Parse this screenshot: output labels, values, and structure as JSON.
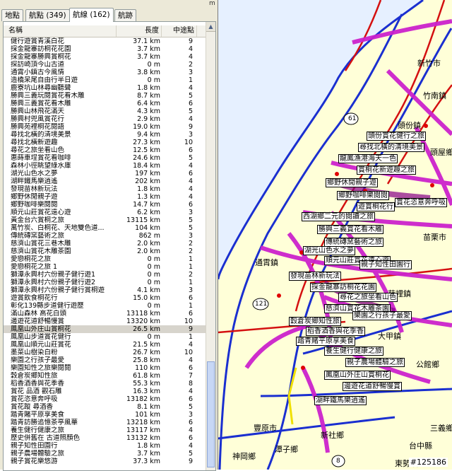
{
  "tabs": [
    {
      "label": "地點",
      "active": false
    },
    {
      "label": "航點 (349)",
      "active": false
    },
    {
      "label": "航線 (162)",
      "active": true
    },
    {
      "label": "航跡",
      "active": false
    }
  ],
  "top_tick": "m",
  "columns": {
    "name": "名稱",
    "length": "長度",
    "waypoints": "中途點"
  },
  "rows": [
    {
      "name": "健行遊賞青溪白花",
      "length": "37.1 km",
      "pts": "9"
    },
    {
      "name": "採金龍寨訪桐花花園",
      "length": "3.7 km",
      "pts": "4"
    },
    {
      "name": "採金龍寨勝興賞桐花",
      "length": "3.7 km",
      "pts": "4"
    },
    {
      "name": "探訪崎頂今山古道",
      "length": "0 m",
      "pts": "2"
    },
    {
      "name": "通霄小鎮古今風情",
      "length": "3.8 km",
      "pts": "3"
    },
    {
      "name": "造橋呆尾自由行半日遊",
      "length": "0 m",
      "pts": "1"
    },
    {
      "name": "鹿寮坑山林尋幽聽聲",
      "length": "1.8 km",
      "pts": "4"
    },
    {
      "name": "勝興三義玩閱賞花看木雕",
      "length": "8.7 km",
      "pts": "5"
    },
    {
      "name": "勝興三義賞花看木雕",
      "length": "6.4 km",
      "pts": "6"
    },
    {
      "name": "勝興山林飛花滿天",
      "length": "4.3 km",
      "pts": "5"
    },
    {
      "name": "勝興村兜風賞花行",
      "length": "2.9 km",
      "pts": "4"
    },
    {
      "name": "勝興苑裡桐花閱語",
      "length": "19.0 km",
      "pts": "9"
    },
    {
      "name": "尋找北橫的清境美景",
      "length": "9.4 km",
      "pts": "3"
    },
    {
      "name": "尋找北橫新遊趣",
      "length": "27.3 km",
      "pts": "10"
    },
    {
      "name": "尋花之旅坐看山色",
      "length": "12.5 km",
      "pts": "6"
    },
    {
      "name": "惠蒔車埕賞花看咖啡",
      "length": "24.6 km",
      "pts": "5"
    },
    {
      "name": "森林小徑眺望綠水庫",
      "length": "18.4 km",
      "pts": "4"
    },
    {
      "name": "湖光山色水之夢",
      "length": "197 km",
      "pts": "6"
    },
    {
      "name": "湖畔鐵馬樂逍遙",
      "length": "202 km",
      "pts": "4"
    },
    {
      "name": "發現苗林新玩法",
      "length": "1.8 km",
      "pts": "4"
    },
    {
      "name": "鄉野休閒親子遊",
      "length": "1.3 km",
      "pts": "4"
    },
    {
      "name": "鄉野咖啡樂閱閱",
      "length": "14.7 km",
      "pts": "6"
    },
    {
      "name": "順元山莊賞花遠心遊",
      "length": "6.2 km",
      "pts": "3"
    },
    {
      "name": "黃金台六賞桐之旅",
      "length": "13115 km",
      "pts": "5"
    },
    {
      "name": "萬竹炭、白桐花、天地雙色道...",
      "length": "104 km",
      "pts": "5"
    },
    {
      "name": "傳統磚窯藝術之旅",
      "length": "862 m",
      "pts": "3"
    },
    {
      "name": "慈濟山賞花三巷木雕",
      "length": "2.0 km",
      "pts": "2"
    },
    {
      "name": "慈濟山賞花木雕茶園",
      "length": "2.0 km",
      "pts": "2"
    },
    {
      "name": "愛戀桐花之旅",
      "length": "0 m",
      "pts": "1"
    },
    {
      "name": "愛戀桐花之旅 1",
      "length": "0 m",
      "pts": "1"
    },
    {
      "name": "獅潭永興村六份親子健行遊1",
      "length": "0 m",
      "pts": "2"
    },
    {
      "name": "獅潭永興村六份親子健行遊2",
      "length": "0 m",
      "pts": "1"
    },
    {
      "name": "獅潭永興村六份親子健行賞桐遊",
      "length": "4.1 km",
      "pts": "3"
    },
    {
      "name": "遊賞飲食桐花行",
      "length": "15.0 km",
      "pts": "6"
    },
    {
      "name": "彰化139縣步道健行遊歷",
      "length": "0 m",
      "pts": "1"
    },
    {
      "name": "滿山森林 高花白頭",
      "length": "13118 km",
      "pts": "6"
    },
    {
      "name": "邊遊花道舒暢慢賞",
      "length": "13320 km",
      "pts": "10"
    },
    {
      "name": "鳳凰山外庄山賞桐花",
      "length": "26.5 km",
      "pts": "9",
      "selected": true
    },
    {
      "name": "鳳凰山步道賞花健行",
      "length": "0 m",
      "pts": "1"
    },
    {
      "name": "鳳凰山順元山莊賞花",
      "length": "21.5 km",
      "pts": "4"
    },
    {
      "name": "墨菜山樹染白粉",
      "length": "26.7 km",
      "pts": "10"
    },
    {
      "name": "樂園之行孩子最愛",
      "length": "25.8 km",
      "pts": "4"
    },
    {
      "name": "樂園知性之旅樂閱閱",
      "length": "110 km",
      "pts": "6"
    },
    {
      "name": "穀倉炭鄉知性旅",
      "length": "61.8 km",
      "pts": "7"
    },
    {
      "name": "稻香酒香與花季香",
      "length": "55.3 km",
      "pts": "8"
    },
    {
      "name": "賞花 品酒 觀石雕",
      "length": "16.3 km",
      "pts": "4"
    },
    {
      "name": "賞花恣意奔呼吸",
      "length": "13182 km",
      "pts": "6"
    },
    {
      "name": "賞花蹤  尋酒香",
      "length": "8.1 km",
      "pts": "5"
    },
    {
      "name": "踏青賭平原享美食",
      "length": "101 km",
      "pts": "3"
    },
    {
      "name": "踏青訪勝追憶茶亭風華",
      "length": "13218 km",
      "pts": "6"
    },
    {
      "name": "養生健行健康之旅",
      "length": "13117 km",
      "pts": "4"
    },
    {
      "name": "歷史併舊在 古道照顏色",
      "length": "13132 km",
      "pts": "6"
    },
    {
      "name": "親子知性田園行",
      "length": "1.8 km",
      "pts": "4"
    },
    {
      "name": "親子農場體驗之旅",
      "length": "3.7 km",
      "pts": "5"
    },
    {
      "name": "親子賞花樂悠游",
      "length": "37.3 km",
      "pts": "9"
    }
  ],
  "map": {
    "road_labels": [
      "61",
      "121",
      "8"
    ],
    "text_labels": [
      "頭份鎮",
      "新竹市",
      "造橋鄉",
      "通霄鎮",
      "苑裡鎮",
      "大甲鎮",
      "竹南鎮",
      "頭屋鄉",
      "苗栗市",
      "公館鄉",
      "三義鄉",
      "豐原市",
      "神岡鄉",
      "新社鄉",
      "潭子鄉",
      "台中縣",
      "石岡鄉",
      "東勢鎮"
    ],
    "poi_labels": [
      "頭份賞花健行之旅",
      "尋找北橫的清境美景",
      "龍鳳漁港海天一色",
      "賞桐花新遊趣之旅",
      "鄉野休閒親子遊",
      "鄉野咖啡樂閱閱",
      "遊賞桐花行",
      "賞花恣意奔呼吸",
      "西湖鄉二元的閱讀之旅",
      "勝興三義賞花看木雕",
      "傳統磚窯藝術之旅",
      "湖光山色水之夢",
      "順元山莊賞花遠心遊",
      "親子知性田園行",
      "發現苗林新玩法",
      "採金龍寨訪桐花花園",
      "尋花之旅坐看山色",
      "慈濟山賞花木雕茶園",
      "樂園之行孩子最愛",
      "穀倉炭鄉知性旅",
      "稻香酒香與花季香",
      "踏青賭平原享美食",
      "養生健行健康之旅",
      "親子農場體驗之旅",
      "鳳凰山外庄山賞桐花",
      "邊遊花道舒暢慢賞",
      "湖畔鐵馬樂逍遙"
    ],
    "watermark": "#125186"
  },
  "colors": {
    "route": "#cc22cc",
    "route_dark": "#880088",
    "road": "#1a2fd0",
    "red_road": "#d41010",
    "sea": "#e6f0ff",
    "land": "#ffffd8"
  }
}
